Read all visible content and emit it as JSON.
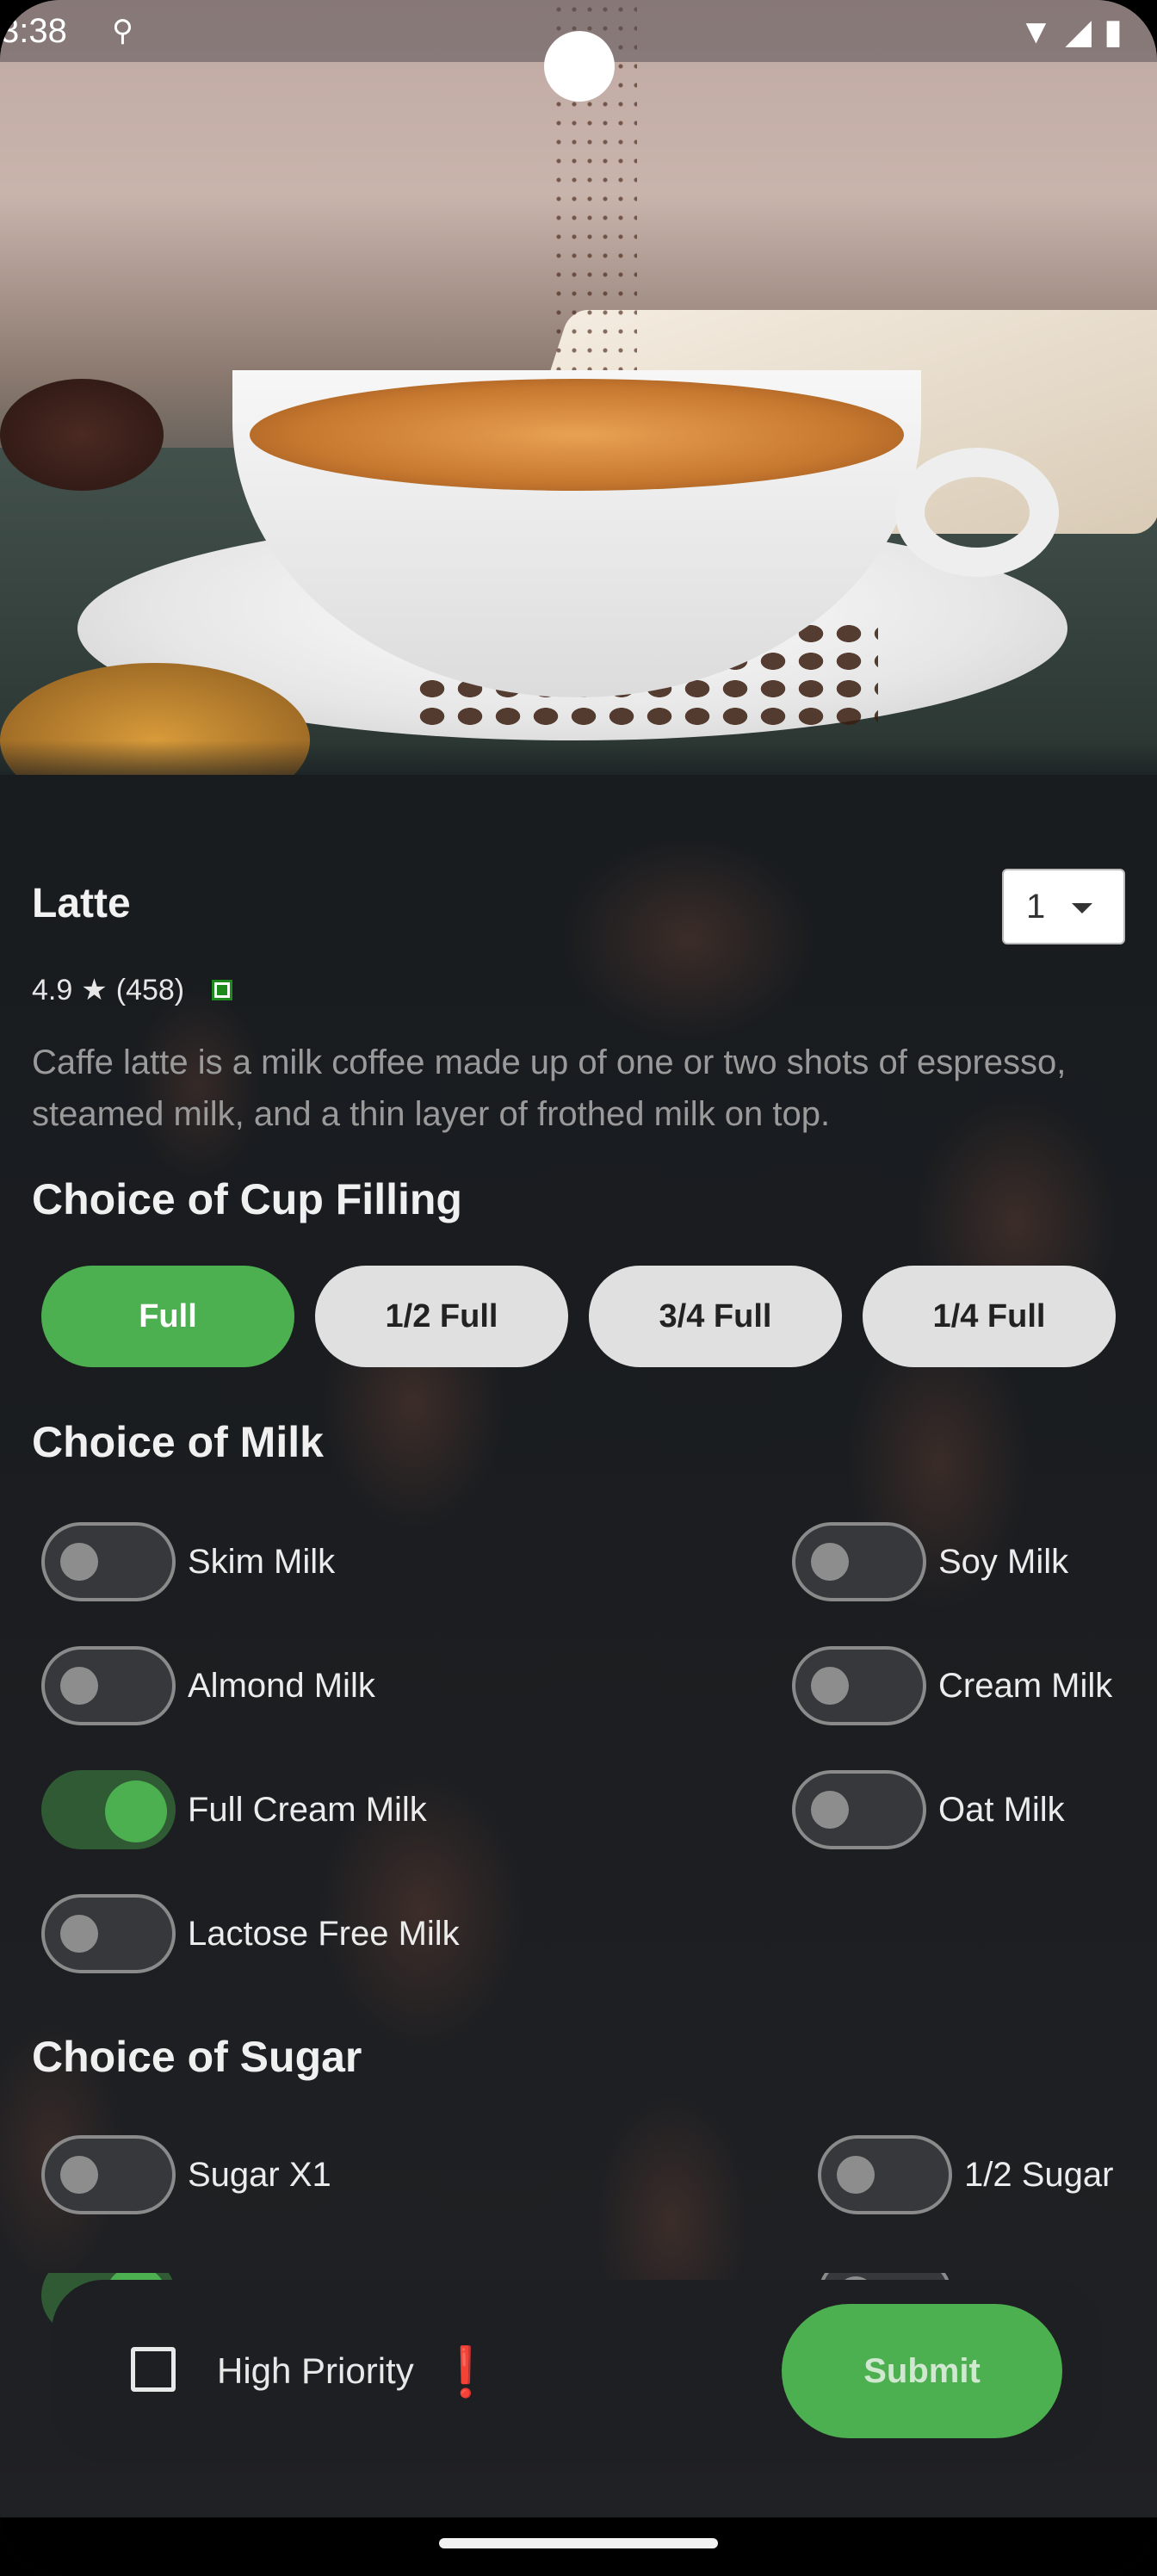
{
  "status_bar": {
    "time": "3:38",
    "app_icon": "app-notification-icon",
    "icons": [
      "wifi-icon",
      "signal-icon",
      "battery-icon"
    ]
  },
  "product": {
    "name": "Latte",
    "quantity": "1",
    "rating": "4.9",
    "rating_star": "★",
    "review_count": "(458)",
    "description": "Caffe latte is a milk coffee made up of one or two shots of espresso, steamed milk, and a thin layer of frothed milk on top."
  },
  "cup_filling": {
    "heading": "Choice of Cup Filling",
    "options": [
      "Full",
      "1/2 Full",
      "3/4 Full",
      "1/4 Full"
    ],
    "selected": "Full"
  },
  "milk": {
    "heading": "Choice of Milk",
    "options": [
      {
        "label": "Skim Milk",
        "on": false
      },
      {
        "label": "Soy Milk",
        "on": false
      },
      {
        "label": "Almond Milk",
        "on": false
      },
      {
        "label": "Cream Milk",
        "on": false
      },
      {
        "label": "Full Cream Milk",
        "on": true
      },
      {
        "label": "Oat Milk",
        "on": false
      },
      {
        "label": "Lactose Free Milk",
        "on": false
      }
    ]
  },
  "sugar": {
    "heading": "Choice of Sugar",
    "options": [
      {
        "label": "Sugar X1",
        "on": false
      },
      {
        "label": "1/2 Sugar",
        "on": false
      }
    ]
  },
  "bottom_bar": {
    "priority_label": "High Priority",
    "priority_mark": "❗",
    "priority_checked": false,
    "submit_label": "Submit"
  },
  "colors": {
    "accent": "#4caf50",
    "background": "#1b1d20",
    "priority_mark": "#e53935"
  }
}
